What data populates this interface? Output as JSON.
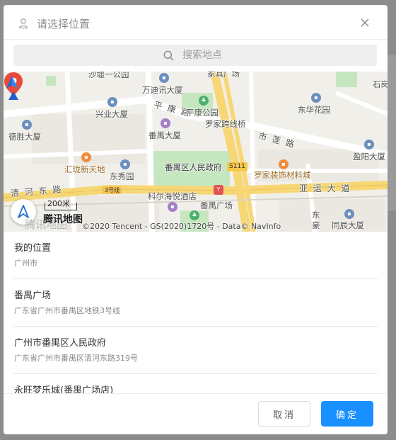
{
  "dialog": {
    "title": "请选择位置",
    "icons": {
      "header": "person-pin-icon",
      "close": "close-icon"
    }
  },
  "search": {
    "placeholder": "搜索地点",
    "icon": "search-icon"
  },
  "map": {
    "labels": {
      "shaiyi": "沙墟一公园",
      "jiayi": "家具广场",
      "shigang": "石岗",
      "wandi": "万迪讯大厦",
      "xingye": "兴业大厦",
      "pingkang_road": "平 康 路",
      "pingkang_park": "平康公园",
      "donghua": "东华花园",
      "panyu_bldg": "番禺大厦",
      "luojia_bridge": "罗家跨线桥",
      "desheng": "德胜大厦",
      "shilian_road": "市 莲 路",
      "yingyang": "盈阳大厦",
      "huilong": "汇珑新天地",
      "dongxiu": "东秀园",
      "gov": "番禺区人民政府",
      "s111": "S111",
      "luojia_deco": "罗家装饰材料城",
      "qinghe_road": "清 河 东 路",
      "r3": "3号线",
      "yayun": "亚 运 大 道",
      "kerhai": "科尔海悦酒店",
      "panyu_square": "番禺广场",
      "dong": "东",
      "hao": "豪",
      "tongchen": "同辰大厦"
    },
    "scale": "200米",
    "logo_text": "腾讯地图",
    "logo_ghost": "腾讯地图",
    "copyright": "©2020 Tencent - GS(2020)1720号 - Data© NavInfo",
    "colors": {
      "land": "#f1efe9",
      "park": "#c6e6c0",
      "major_road": "#f7d775",
      "minor_road": "#ffffff",
      "marker": "#ea4a3c",
      "accent": "#1890ff"
    }
  },
  "results": [
    {
      "name": "我的位置",
      "address": "广州市"
    },
    {
      "name": "番禺广场",
      "address": "广东省广州市番禺区地铁3号线"
    },
    {
      "name": "广州市番禺区人民政府",
      "address": "广东省广州市番禺区清河东路319号"
    },
    {
      "name": "永旺梦乐城(番禺广场店)",
      "address": ""
    }
  ],
  "footer": {
    "cancel_label": "取消",
    "confirm_label": "确定"
  }
}
